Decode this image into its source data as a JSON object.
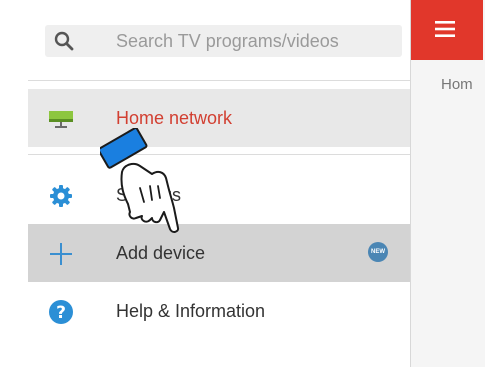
{
  "search": {
    "placeholder": "Search TV programs/videos",
    "icon": "search-icon"
  },
  "menu": {
    "items": [
      {
        "label": "Home network",
        "icon": "network-icon",
        "state": "selected"
      },
      {
        "label": "Settings",
        "icon": "gear-icon"
      },
      {
        "label": "Add device",
        "icon": "plus-icon",
        "badge": "NEW",
        "state": "pressed"
      },
      {
        "label": "Help & Information",
        "icon": "help-icon"
      }
    ]
  },
  "right_panel": {
    "menu_icon": "hamburger-icon",
    "breadcrumb": "Hom"
  },
  "colors": {
    "accent": "#e1372b",
    "selected_text": "#d23f31",
    "icon_blue": "#2b8fd6",
    "badge": "#4b86b4"
  }
}
